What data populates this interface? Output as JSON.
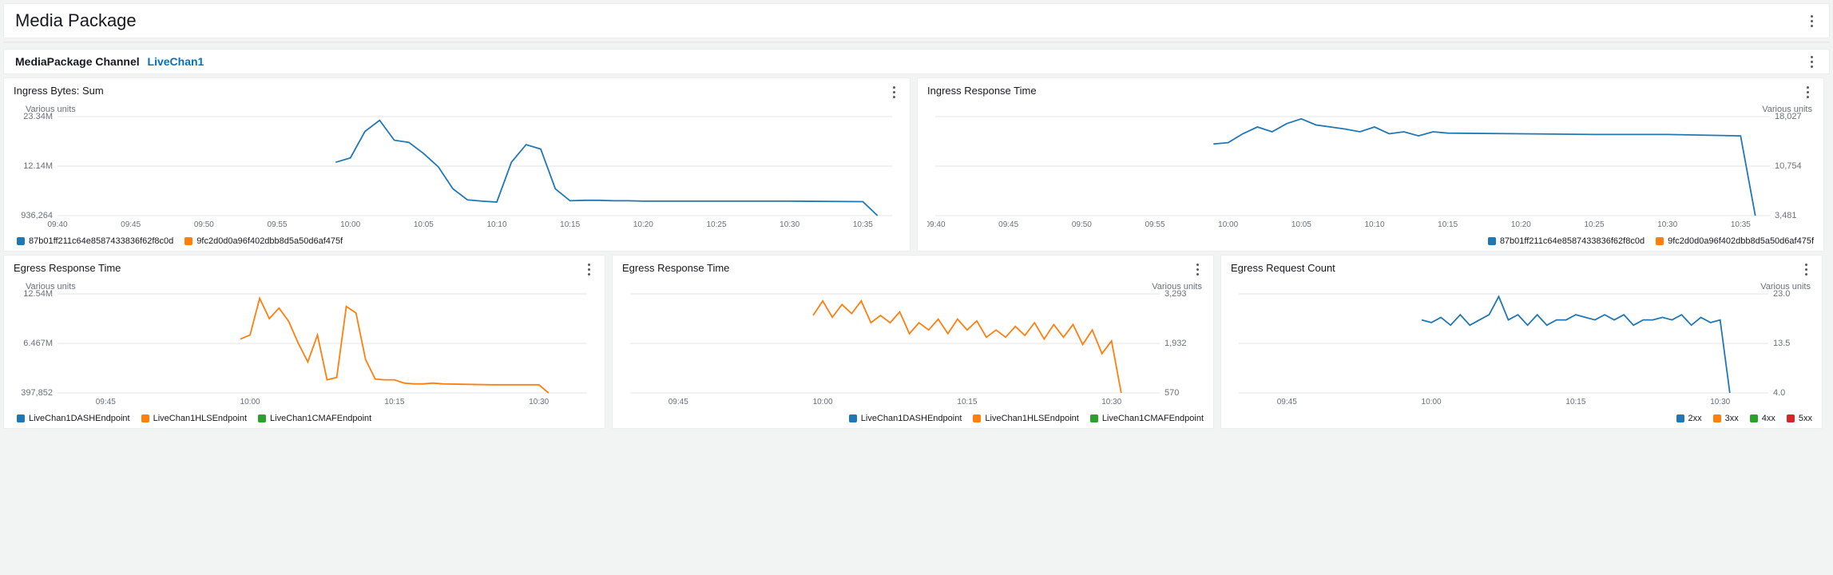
{
  "header": {
    "title": "Media Package",
    "channel_label": "MediaPackage Channel",
    "channel_link": "LiveChan1"
  },
  "colors": {
    "blue": "#1f77b4",
    "orange": "#ff7f0e",
    "green": "#2ca02c",
    "red": "#d62728"
  },
  "panels": {
    "ingress_bytes": {
      "title": "Ingress Bytes: Sum",
      "units_label": "Various units",
      "legend": [
        {
          "name": "87b01ff211c64e8587433836f62f8c0d",
          "color": "blue"
        },
        {
          "name": "9fc2d0d0a96f402dbb8d5a50d6af475f",
          "color": "orange"
        }
      ]
    },
    "ingress_rt": {
      "title": "Ingress Response Time",
      "units_label": "Various units",
      "legend": [
        {
          "name": "87b01ff211c64e8587433836f62f8c0d",
          "color": "blue"
        },
        {
          "name": "9fc2d0d0a96f402dbb8d5a50d6af475f",
          "color": "orange"
        }
      ]
    },
    "egress_rt_left": {
      "title": "Egress Response Time",
      "units_label": "Various units",
      "legend": [
        {
          "name": "LiveChan1DASHEndpoint",
          "color": "blue"
        },
        {
          "name": "LiveChan1HLSEndpoint",
          "color": "orange"
        },
        {
          "name": "LiveChan1CMAFEndpoint",
          "color": "green"
        }
      ]
    },
    "egress_rt_mid": {
      "title": "Egress Response Time",
      "units_label": "Various units",
      "legend": [
        {
          "name": "LiveChan1DASHEndpoint",
          "color": "blue"
        },
        {
          "name": "LiveChan1HLSEndpoint",
          "color": "orange"
        },
        {
          "name": "LiveChan1CMAFEndpoint",
          "color": "green"
        }
      ]
    },
    "egress_req": {
      "title": "Egress Request Count",
      "units_label": "Various units",
      "legend": [
        {
          "name": "2xx",
          "color": "blue"
        },
        {
          "name": "3xx",
          "color": "orange"
        },
        {
          "name": "4xx",
          "color": "green"
        },
        {
          "name": "5xx",
          "color": "red"
        }
      ]
    }
  },
  "chart_data": [
    {
      "id": "ingress_bytes",
      "type": "line",
      "title": "Ingress Bytes: Sum",
      "x_ticks": [
        "09:40",
        "09:45",
        "09:50",
        "09:55",
        "10:00",
        "10:05",
        "10:10",
        "10:15",
        "10:20",
        "10:25",
        "10:30",
        "10:35"
      ],
      "y_ticks_left": [
        "23.34M",
        "12.14M",
        "936,264"
      ],
      "y_side": "left",
      "xrange": [
        "09:40",
        "10:37"
      ],
      "ylim": [
        936264,
        23340000
      ],
      "series": [
        {
          "name": "87b01ff211c64e8587433836f62f8c0d",
          "color": "blue",
          "x": [
            "09:59",
            "10:00",
            "10:01",
            "10:02",
            "10:03",
            "10:04",
            "10:05",
            "10:06",
            "10:07",
            "10:08",
            "10:09",
            "10:10",
            "10:11",
            "10:12",
            "10:13",
            "10:14",
            "10:15",
            "10:16",
            "10:17",
            "10:18",
            "10:19",
            "10:20",
            "10:25",
            "10:30",
            "10:35",
            "10:36"
          ],
          "y": [
            13000000,
            14000000,
            20000000,
            22500000,
            18000000,
            17500000,
            15000000,
            12000000,
            7000000,
            4500000,
            4200000,
            4000000,
            13000000,
            17000000,
            16000000,
            7000000,
            4300000,
            4400000,
            4400000,
            4300000,
            4300000,
            4200000,
            4200000,
            4200000,
            4100000,
            936264
          ]
        }
      ]
    },
    {
      "id": "ingress_rt",
      "type": "line",
      "title": "Ingress Response Time",
      "x_ticks": [
        "09:40",
        "09:45",
        "09:50",
        "09:55",
        "10:00",
        "10:05",
        "10:10",
        "10:15",
        "10:20",
        "10:25",
        "10:30",
        "10:35"
      ],
      "y_ticks_right": [
        "18,027",
        "10,754",
        "3,481"
      ],
      "y_side": "right",
      "xrange": [
        "09:40",
        "10:37"
      ],
      "ylim": [
        3481,
        18027
      ],
      "series": [
        {
          "name": "87b01ff211c64e8587433836f62f8c0d",
          "color": "blue",
          "x": [
            "09:59",
            "10:00",
            "10:01",
            "10:02",
            "10:03",
            "10:04",
            "10:05",
            "10:06",
            "10:07",
            "10:08",
            "10:09",
            "10:10",
            "10:11",
            "10:12",
            "10:13",
            "10:14",
            "10:15",
            "10:20",
            "10:25",
            "10:30",
            "10:35",
            "10:36"
          ],
          "y": [
            14000,
            14200,
            15500,
            16500,
            15800,
            17000,
            17700,
            16800,
            16500,
            16200,
            15800,
            16500,
            15500,
            15800,
            15200,
            15800,
            15600,
            15500,
            15400,
            15400,
            15200,
            3481
          ]
        }
      ]
    },
    {
      "id": "egress_rt_left",
      "type": "line",
      "title": "Egress Response Time",
      "x_ticks": [
        "09:45",
        "10:00",
        "10:15",
        "10:30"
      ],
      "y_ticks_left": [
        "12.54M",
        "6.467M",
        "397,852"
      ],
      "y_side": "left",
      "xrange": [
        "09:40",
        "10:35"
      ],
      "ylim": [
        397852,
        12540000
      ],
      "series": [
        {
          "name": "LiveChan1HLSEndpoint",
          "color": "orange",
          "x": [
            "09:59",
            "10:00",
            "10:01",
            "10:02",
            "10:03",
            "10:04",
            "10:05",
            "10:06",
            "10:07",
            "10:08",
            "10:09",
            "10:10",
            "10:11",
            "10:12",
            "10:13",
            "10:14",
            "10:15",
            "10:16",
            "10:17",
            "10:18",
            "10:19",
            "10:20",
            "10:25",
            "10:30",
            "10:31"
          ],
          "y": [
            7000000,
            7500000,
            12000000,
            9500000,
            10800000,
            9200000,
            6500000,
            4200000,
            7500000,
            2000000,
            2300000,
            11000000,
            10200000,
            4500000,
            2100000,
            2000000,
            2000000,
            1600000,
            1500000,
            1500000,
            1600000,
            1500000,
            1400000,
            1400000,
            397852
          ]
        }
      ]
    },
    {
      "id": "egress_rt_mid",
      "type": "line",
      "title": "Egress Response Time",
      "x_ticks": [
        "09:45",
        "10:00",
        "10:15",
        "10:30"
      ],
      "y_ticks_right": [
        "3,293",
        "1,932",
        "570"
      ],
      "y_side": "right",
      "xrange": [
        "09:40",
        "10:35"
      ],
      "ylim": [
        570,
        3293
      ],
      "series": [
        {
          "name": "LiveChan1HLSEndpoint",
          "color": "orange",
          "x": [
            "09:59",
            "10:00",
            "10:01",
            "10:02",
            "10:03",
            "10:04",
            "10:05",
            "10:06",
            "10:07",
            "10:08",
            "10:09",
            "10:10",
            "10:11",
            "10:12",
            "10:13",
            "10:14",
            "10:15",
            "10:16",
            "10:17",
            "10:18",
            "10:19",
            "10:20",
            "10:21",
            "10:22",
            "10:23",
            "10:24",
            "10:25",
            "10:26",
            "10:27",
            "10:28",
            "10:29",
            "10:30",
            "10:31"
          ],
          "y": [
            2700,
            3100,
            2650,
            3000,
            2750,
            3100,
            2500,
            2700,
            2500,
            2800,
            2200,
            2500,
            2300,
            2600,
            2200,
            2600,
            2300,
            2550,
            2100,
            2300,
            2100,
            2400,
            2150,
            2500,
            2050,
            2450,
            2100,
            2450,
            1900,
            2300,
            1650,
            2000,
            570
          ]
        }
      ]
    },
    {
      "id": "egress_req",
      "type": "line",
      "title": "Egress Request Count",
      "x_ticks": [
        "09:45",
        "10:00",
        "10:15",
        "10:30"
      ],
      "y_ticks_right": [
        "23.0",
        "13.5",
        "4.0"
      ],
      "y_side": "right",
      "xrange": [
        "09:40",
        "10:35"
      ],
      "ylim": [
        4.0,
        23.0
      ],
      "series": [
        {
          "name": "2xx",
          "color": "blue",
          "x": [
            "09:59",
            "10:00",
            "10:01",
            "10:02",
            "10:03",
            "10:04",
            "10:05",
            "10:06",
            "10:07",
            "10:08",
            "10:09",
            "10:10",
            "10:11",
            "10:12",
            "10:13",
            "10:14",
            "10:15",
            "10:16",
            "10:17",
            "10:18",
            "10:19",
            "10:20",
            "10:21",
            "10:22",
            "10:23",
            "10:24",
            "10:25",
            "10:26",
            "10:27",
            "10:28",
            "10:29",
            "10:30",
            "10:31"
          ],
          "y": [
            18,
            17.5,
            18.5,
            17,
            19,
            17,
            18,
            19,
            22.5,
            18,
            19,
            17,
            19,
            17,
            18,
            18,
            19,
            18.5,
            18,
            19,
            18,
            19,
            17,
            18,
            18,
            18.5,
            18,
            19,
            17,
            18.5,
            17.5,
            18,
            4
          ]
        }
      ]
    }
  ],
  "time_label_map": {
    "09:40": 0,
    "09:41": 1,
    "09:42": 2,
    "09:43": 3,
    "09:44": 4,
    "09:45": 5,
    "09:46": 6,
    "09:47": 7,
    "09:48": 8,
    "09:49": 9,
    "09:50": 10,
    "09:51": 11,
    "09:52": 12,
    "09:53": 13,
    "09:54": 14,
    "09:55": 15,
    "09:56": 16,
    "09:57": 17,
    "09:58": 18,
    "09:59": 19,
    "10:00": 20,
    "10:01": 21,
    "10:02": 22,
    "10:03": 23,
    "10:04": 24,
    "10:05": 25,
    "10:06": 26,
    "10:07": 27,
    "10:08": 28,
    "10:09": 29,
    "10:10": 30,
    "10:11": 31,
    "10:12": 32,
    "10:13": 33,
    "10:14": 34,
    "10:15": 35,
    "10:16": 36,
    "10:17": 37,
    "10:18": 38,
    "10:19": 39,
    "10:20": 40,
    "10:21": 41,
    "10:22": 42,
    "10:23": 43,
    "10:24": 44,
    "10:25": 45,
    "10:26": 46,
    "10:27": 47,
    "10:28": 48,
    "10:29": 49,
    "10:30": 50,
    "10:31": 51,
    "10:32": 52,
    "10:33": 53,
    "10:34": 54,
    "10:35": 55,
    "10:36": 56,
    "10:37": 57
  }
}
